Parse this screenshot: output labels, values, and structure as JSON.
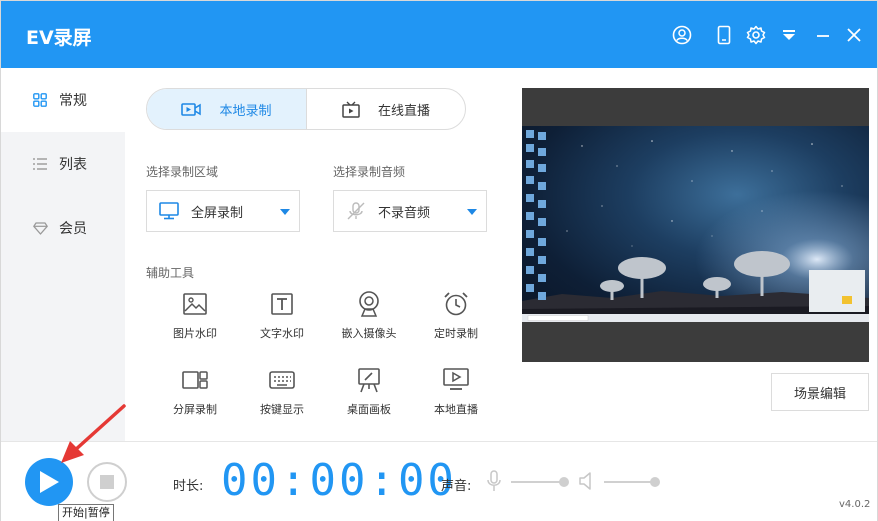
{
  "app": {
    "title": "EV录屏"
  },
  "titlebar": {
    "icons": [
      "user-icon",
      "phone-icon",
      "gear-icon",
      "dropdown-menu-icon",
      "minimize-icon",
      "close-icon"
    ]
  },
  "sidebar": {
    "items": [
      {
        "label": "常规",
        "icon": "grid-icon",
        "active": true
      },
      {
        "label": "列表",
        "icon": "list-icon",
        "active": false
      },
      {
        "label": "会员",
        "icon": "diamond-icon",
        "active": false
      }
    ]
  },
  "tabs": [
    {
      "label": "本地录制",
      "icon": "record-camera-icon",
      "active": true
    },
    {
      "label": "在线直播",
      "icon": "tv-icon",
      "active": false
    }
  ],
  "area": {
    "label": "选择录制区域",
    "value": "全屏录制",
    "icon": "monitor-icon"
  },
  "audio": {
    "label": "选择录制音频",
    "value": "不录音频",
    "icon": "mic-off-icon"
  },
  "tools": {
    "label": "辅助工具",
    "items": [
      {
        "label": "图片水印",
        "icon": "image-icon"
      },
      {
        "label": "文字水印",
        "icon": "text-icon"
      },
      {
        "label": "嵌入摄像头",
        "icon": "webcam-icon"
      },
      {
        "label": "定时录制",
        "icon": "alarm-clock-icon"
      },
      {
        "label": "分屏录制",
        "icon": "split-screen-icon"
      },
      {
        "label": "按键显示",
        "icon": "keyboard-icon"
      },
      {
        "label": "桌面画板",
        "icon": "easel-icon"
      },
      {
        "label": "本地直播",
        "icon": "play-monitor-icon"
      }
    ]
  },
  "preview": {
    "scene_button": "场景编辑"
  },
  "bottom": {
    "duration_label": "时长:",
    "timer": "00:00:00",
    "sound_label": "声音:",
    "tooltip": "开始|暂停",
    "version": "v4.0.2"
  },
  "colors": {
    "accent": "#2196f3",
    "sidebar_bg": "#f3f4f6",
    "tab_active_bg": "#e3f2fd",
    "arrow": "#e53935"
  }
}
